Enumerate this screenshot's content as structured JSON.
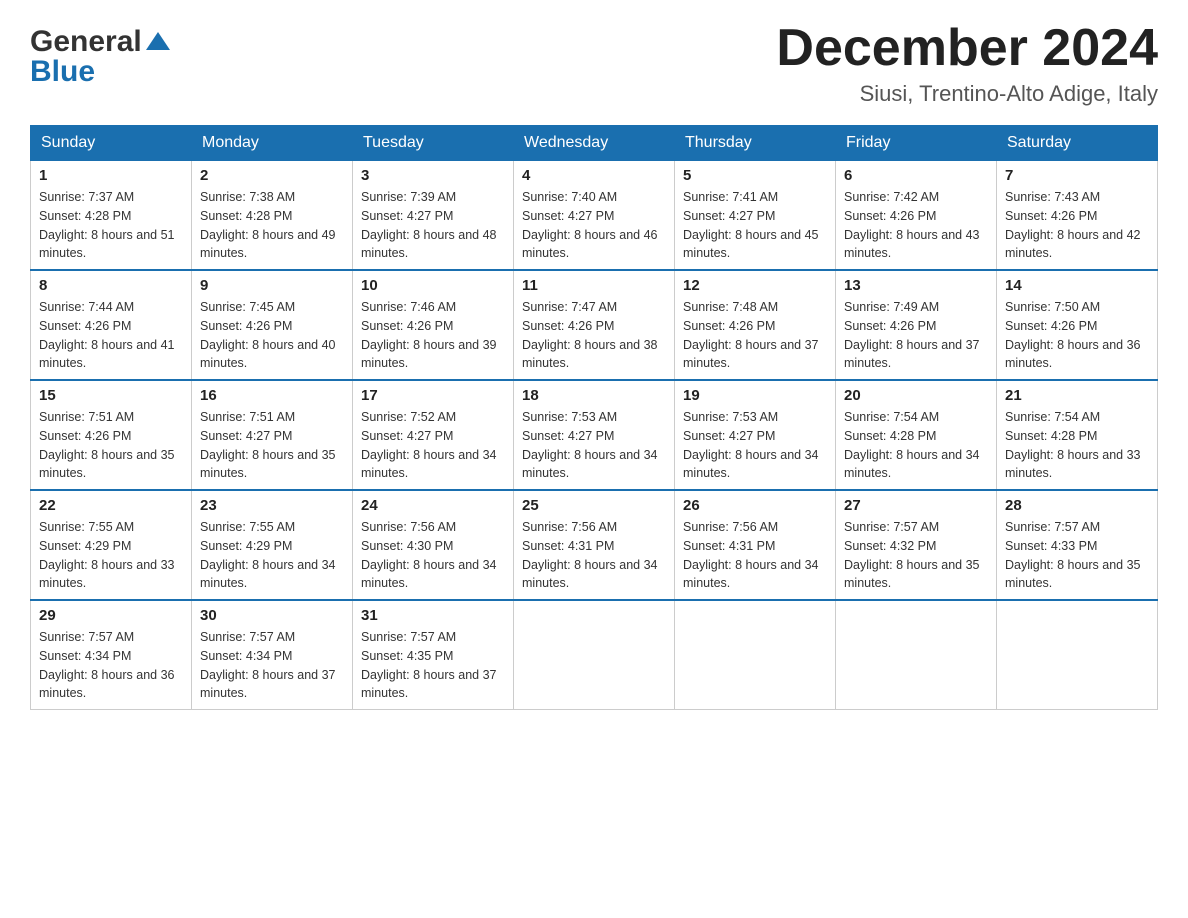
{
  "header": {
    "logo_general": "General",
    "logo_blue": "Blue",
    "month_title": "December 2024",
    "location": "Siusi, Trentino-Alto Adige, Italy"
  },
  "days_of_week": [
    "Sunday",
    "Monday",
    "Tuesday",
    "Wednesday",
    "Thursday",
    "Friday",
    "Saturday"
  ],
  "weeks": [
    [
      {
        "day": "1",
        "sunrise": "Sunrise: 7:37 AM",
        "sunset": "Sunset: 4:28 PM",
        "daylight": "Daylight: 8 hours and 51 minutes."
      },
      {
        "day": "2",
        "sunrise": "Sunrise: 7:38 AM",
        "sunset": "Sunset: 4:28 PM",
        "daylight": "Daylight: 8 hours and 49 minutes."
      },
      {
        "day": "3",
        "sunrise": "Sunrise: 7:39 AM",
        "sunset": "Sunset: 4:27 PM",
        "daylight": "Daylight: 8 hours and 48 minutes."
      },
      {
        "day": "4",
        "sunrise": "Sunrise: 7:40 AM",
        "sunset": "Sunset: 4:27 PM",
        "daylight": "Daylight: 8 hours and 46 minutes."
      },
      {
        "day": "5",
        "sunrise": "Sunrise: 7:41 AM",
        "sunset": "Sunset: 4:27 PM",
        "daylight": "Daylight: 8 hours and 45 minutes."
      },
      {
        "day": "6",
        "sunrise": "Sunrise: 7:42 AM",
        "sunset": "Sunset: 4:26 PM",
        "daylight": "Daylight: 8 hours and 43 minutes."
      },
      {
        "day": "7",
        "sunrise": "Sunrise: 7:43 AM",
        "sunset": "Sunset: 4:26 PM",
        "daylight": "Daylight: 8 hours and 42 minutes."
      }
    ],
    [
      {
        "day": "8",
        "sunrise": "Sunrise: 7:44 AM",
        "sunset": "Sunset: 4:26 PM",
        "daylight": "Daylight: 8 hours and 41 minutes."
      },
      {
        "day": "9",
        "sunrise": "Sunrise: 7:45 AM",
        "sunset": "Sunset: 4:26 PM",
        "daylight": "Daylight: 8 hours and 40 minutes."
      },
      {
        "day": "10",
        "sunrise": "Sunrise: 7:46 AM",
        "sunset": "Sunset: 4:26 PM",
        "daylight": "Daylight: 8 hours and 39 minutes."
      },
      {
        "day": "11",
        "sunrise": "Sunrise: 7:47 AM",
        "sunset": "Sunset: 4:26 PM",
        "daylight": "Daylight: 8 hours and 38 minutes."
      },
      {
        "day": "12",
        "sunrise": "Sunrise: 7:48 AM",
        "sunset": "Sunset: 4:26 PM",
        "daylight": "Daylight: 8 hours and 37 minutes."
      },
      {
        "day": "13",
        "sunrise": "Sunrise: 7:49 AM",
        "sunset": "Sunset: 4:26 PM",
        "daylight": "Daylight: 8 hours and 37 minutes."
      },
      {
        "day": "14",
        "sunrise": "Sunrise: 7:50 AM",
        "sunset": "Sunset: 4:26 PM",
        "daylight": "Daylight: 8 hours and 36 minutes."
      }
    ],
    [
      {
        "day": "15",
        "sunrise": "Sunrise: 7:51 AM",
        "sunset": "Sunset: 4:26 PM",
        "daylight": "Daylight: 8 hours and 35 minutes."
      },
      {
        "day": "16",
        "sunrise": "Sunrise: 7:51 AM",
        "sunset": "Sunset: 4:27 PM",
        "daylight": "Daylight: 8 hours and 35 minutes."
      },
      {
        "day": "17",
        "sunrise": "Sunrise: 7:52 AM",
        "sunset": "Sunset: 4:27 PM",
        "daylight": "Daylight: 8 hours and 34 minutes."
      },
      {
        "day": "18",
        "sunrise": "Sunrise: 7:53 AM",
        "sunset": "Sunset: 4:27 PM",
        "daylight": "Daylight: 8 hours and 34 minutes."
      },
      {
        "day": "19",
        "sunrise": "Sunrise: 7:53 AM",
        "sunset": "Sunset: 4:27 PM",
        "daylight": "Daylight: 8 hours and 34 minutes."
      },
      {
        "day": "20",
        "sunrise": "Sunrise: 7:54 AM",
        "sunset": "Sunset: 4:28 PM",
        "daylight": "Daylight: 8 hours and 34 minutes."
      },
      {
        "day": "21",
        "sunrise": "Sunrise: 7:54 AM",
        "sunset": "Sunset: 4:28 PM",
        "daylight": "Daylight: 8 hours and 33 minutes."
      }
    ],
    [
      {
        "day": "22",
        "sunrise": "Sunrise: 7:55 AM",
        "sunset": "Sunset: 4:29 PM",
        "daylight": "Daylight: 8 hours and 33 minutes."
      },
      {
        "day": "23",
        "sunrise": "Sunrise: 7:55 AM",
        "sunset": "Sunset: 4:29 PM",
        "daylight": "Daylight: 8 hours and 34 minutes."
      },
      {
        "day": "24",
        "sunrise": "Sunrise: 7:56 AM",
        "sunset": "Sunset: 4:30 PM",
        "daylight": "Daylight: 8 hours and 34 minutes."
      },
      {
        "day": "25",
        "sunrise": "Sunrise: 7:56 AM",
        "sunset": "Sunset: 4:31 PM",
        "daylight": "Daylight: 8 hours and 34 minutes."
      },
      {
        "day": "26",
        "sunrise": "Sunrise: 7:56 AM",
        "sunset": "Sunset: 4:31 PM",
        "daylight": "Daylight: 8 hours and 34 minutes."
      },
      {
        "day": "27",
        "sunrise": "Sunrise: 7:57 AM",
        "sunset": "Sunset: 4:32 PM",
        "daylight": "Daylight: 8 hours and 35 minutes."
      },
      {
        "day": "28",
        "sunrise": "Sunrise: 7:57 AM",
        "sunset": "Sunset: 4:33 PM",
        "daylight": "Daylight: 8 hours and 35 minutes."
      }
    ],
    [
      {
        "day": "29",
        "sunrise": "Sunrise: 7:57 AM",
        "sunset": "Sunset: 4:34 PM",
        "daylight": "Daylight: 8 hours and 36 minutes."
      },
      {
        "day": "30",
        "sunrise": "Sunrise: 7:57 AM",
        "sunset": "Sunset: 4:34 PM",
        "daylight": "Daylight: 8 hours and 37 minutes."
      },
      {
        "day": "31",
        "sunrise": "Sunrise: 7:57 AM",
        "sunset": "Sunset: 4:35 PM",
        "daylight": "Daylight: 8 hours and 37 minutes."
      },
      null,
      null,
      null,
      null
    ]
  ]
}
